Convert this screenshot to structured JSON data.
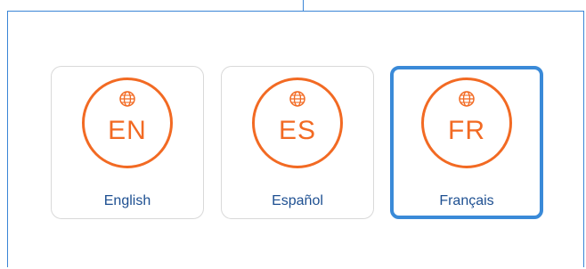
{
  "languages": [
    {
      "code": "EN",
      "label": "English",
      "selected": false
    },
    {
      "code": "ES",
      "label": "Español",
      "selected": false
    },
    {
      "code": "FR",
      "label": "Français",
      "selected": true
    }
  ],
  "icons": {
    "globe": "globe-icon"
  },
  "colors": {
    "accent": "#f26a23",
    "label": "#1d4f91",
    "selected_border": "#3a8ad8",
    "card_border": "#d9d9d9",
    "frame": "#3a85d6"
  }
}
